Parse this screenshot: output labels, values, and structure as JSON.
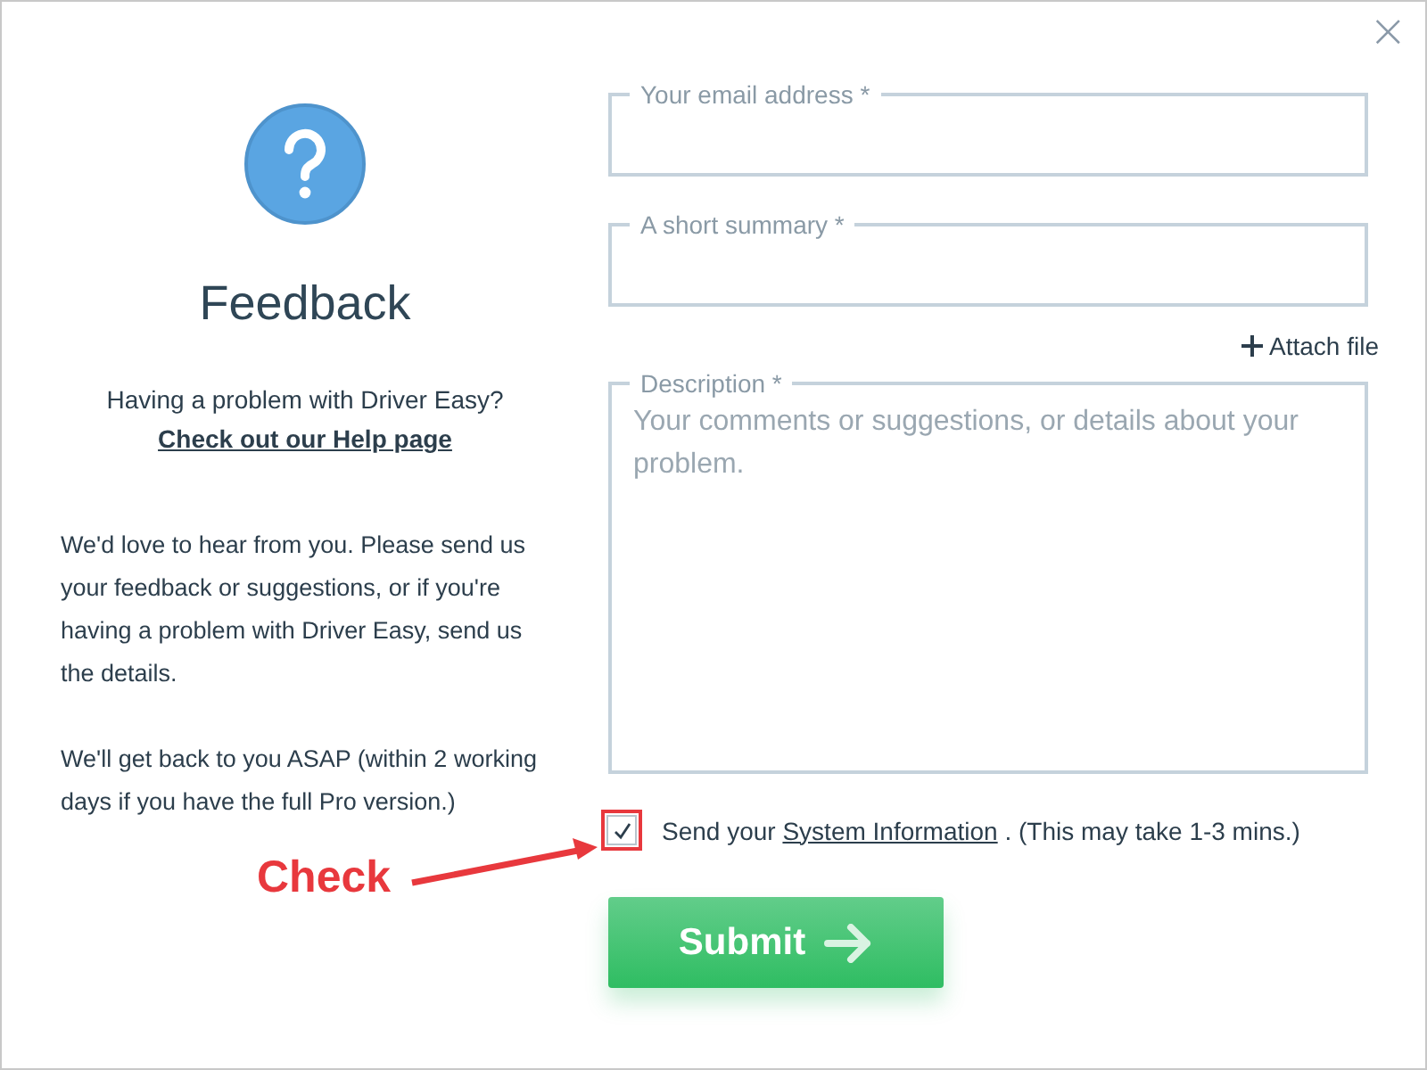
{
  "dialog": {
    "close": "×"
  },
  "left": {
    "title": "Feedback",
    "question": "Having a problem with Driver Easy?",
    "help_link": "Check out our Help page",
    "paragraphs": [
      "We'd love to hear from you. Please send us your feedback or suggestions, or if you're having a problem with Driver Easy, send us the details.",
      "We'll get back to you ASAP (within 2 working days if you have the full Pro version.)"
    ]
  },
  "form": {
    "fields": [
      {
        "kind": "input",
        "label": "Your email address *"
      },
      {
        "kind": "input",
        "label": "A short summary *"
      },
      {
        "kind": "textarea",
        "label": "Description *",
        "placeholder": "Your comments or suggestions, or details about your problem."
      }
    ],
    "attach": "Attach file",
    "system_info": {
      "checked": true,
      "before": "Send your",
      "link": "System Information",
      "after": ". (This may take 1-3 mins.)"
    },
    "submit": "Submit"
  },
  "annotation": {
    "label": "Check"
  }
}
